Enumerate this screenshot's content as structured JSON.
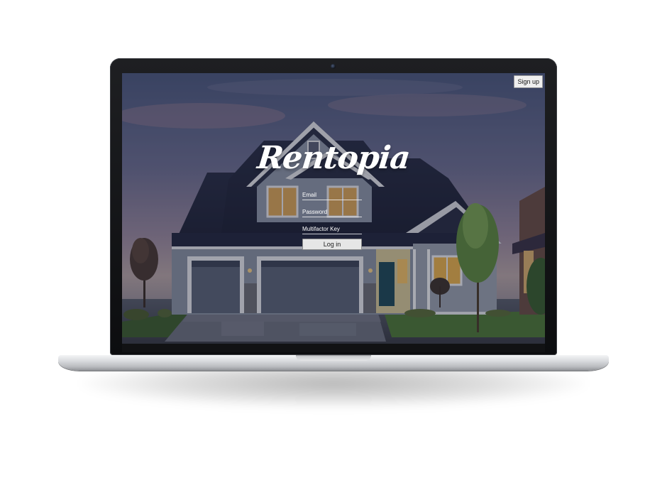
{
  "app": {
    "brand": "Rentopia"
  },
  "header": {
    "signup_label": "Sign up"
  },
  "login_form": {
    "email_placeholder": "Email",
    "password_placeholder": "Password",
    "mfa_placeholder": "Multifactor Key",
    "login_label": "Log in"
  },
  "colors": {
    "brand_text": "#ffffff",
    "button_bg": "#e6e6e6",
    "overlay": "#0f1223"
  },
  "background": {
    "subject": "house-photo"
  }
}
